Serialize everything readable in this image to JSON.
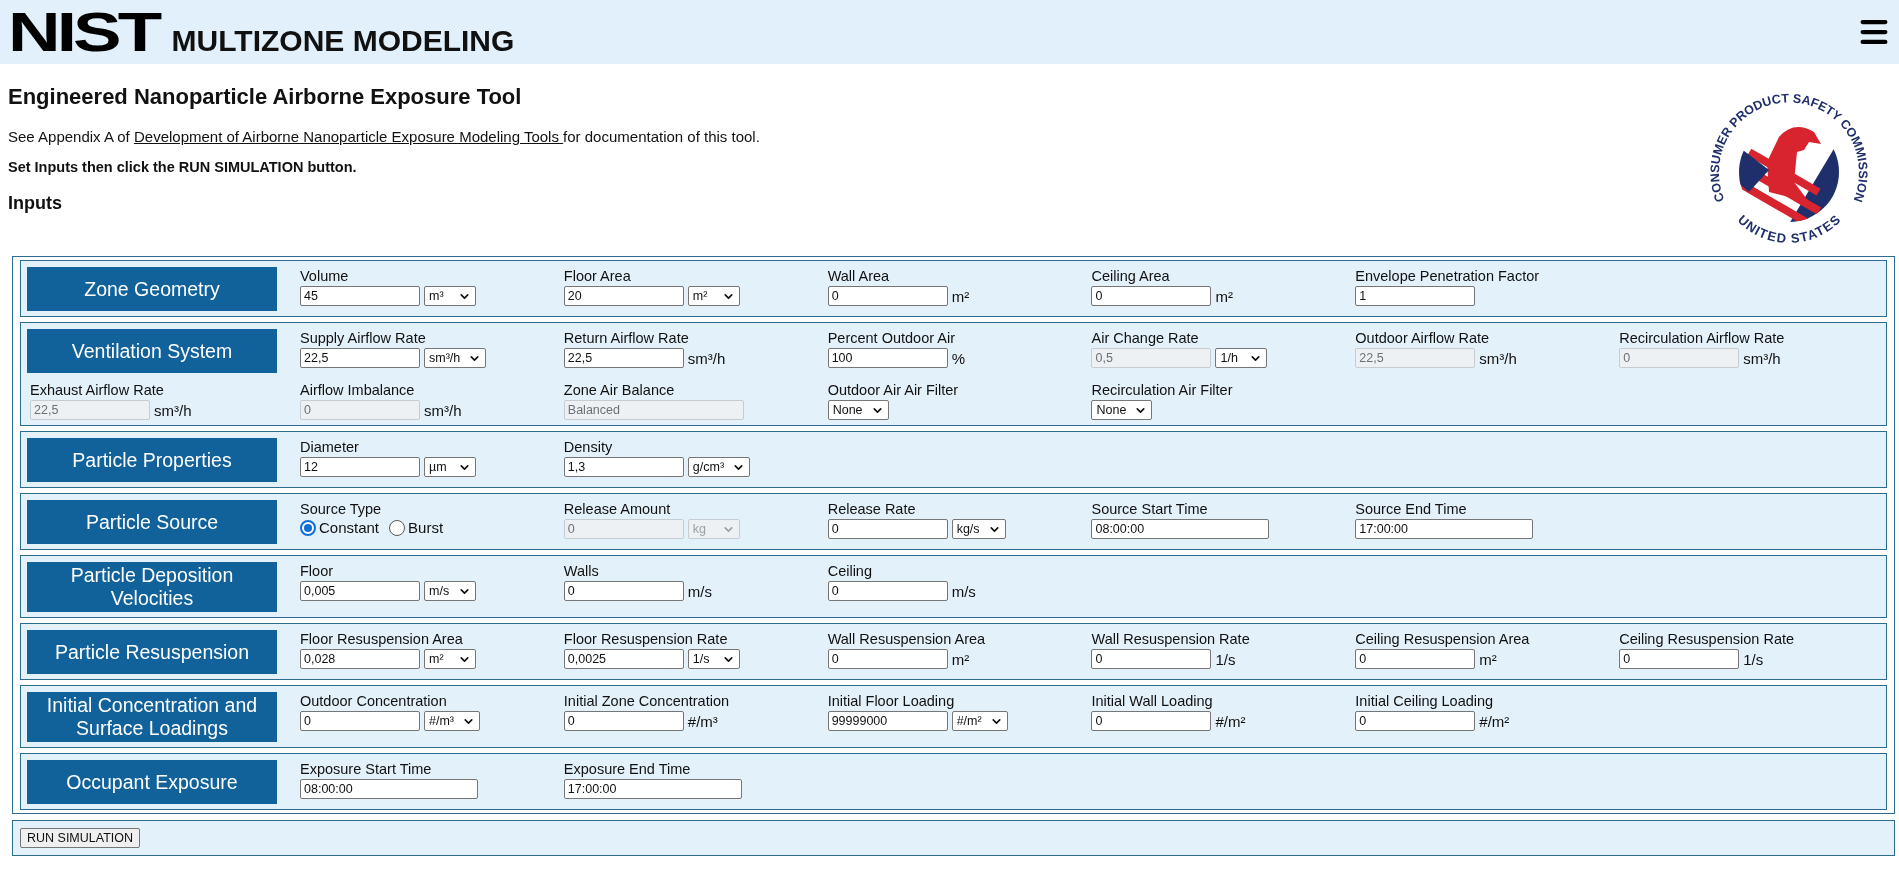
{
  "header": {
    "logo_text": "NIST",
    "title": "MULTIZONE MODELING"
  },
  "page": {
    "title": "Engineered Nanoparticle Airborne Exposure Tool",
    "intro": {
      "before": "See Appendix A of ",
      "link": "Development of Airborne Nanoparticle Exposure Modeling Tools ",
      "after": "for documentation of this tool."
    },
    "instruction": "Set Inputs then click the RUN SIMULATION button.",
    "inputs_heading": "Inputs"
  },
  "seal": {
    "top_text": "CONSUMER PRODUCT SAFETY COMMISSION",
    "bottom_text": "UNITED STATES"
  },
  "sections": [
    {
      "title": "Zone Geometry",
      "fields": [
        {
          "kind": "input",
          "label": "Volume",
          "value": "45",
          "disabled": false,
          "unit": {
            "kind": "select",
            "text": "m³",
            "disabled": false
          }
        },
        {
          "kind": "input",
          "label": "Floor Area",
          "value": "20",
          "disabled": false,
          "unit": {
            "kind": "select",
            "text": "m²",
            "disabled": false
          }
        },
        {
          "kind": "input",
          "label": "Wall Area",
          "value": "0",
          "disabled": false,
          "unit": {
            "kind": "text",
            "text": "m²"
          }
        },
        {
          "kind": "input",
          "label": "Ceiling Area",
          "value": "0",
          "disabled": false,
          "unit": {
            "kind": "text",
            "text": "m²"
          }
        },
        {
          "kind": "input",
          "label": "Envelope Penetration Factor",
          "value": "1",
          "disabled": false
        }
      ]
    },
    {
      "title": "Ventilation System",
      "fields": [
        {
          "kind": "input",
          "label": "Supply Airflow Rate",
          "value": "22,5",
          "disabled": false,
          "unit": {
            "kind": "select",
            "text": "sm³/h",
            "disabled": false
          }
        },
        {
          "kind": "input",
          "label": "Return Airflow Rate",
          "value": "22,5",
          "disabled": false,
          "unit": {
            "kind": "text",
            "text": "sm³/h"
          }
        },
        {
          "kind": "input",
          "label": "Percent Outdoor Air",
          "value": "100",
          "disabled": false,
          "unit": {
            "kind": "text",
            "text": "%"
          }
        },
        {
          "kind": "input",
          "label": "Air Change Rate",
          "value": "0,5",
          "disabled": true,
          "unit": {
            "kind": "select",
            "text": "1/h",
            "disabled": false
          }
        },
        {
          "kind": "input",
          "label": "Outdoor Airflow Rate",
          "value": "22,5",
          "disabled": true,
          "unit": {
            "kind": "text",
            "text": "sm³/h"
          }
        },
        {
          "kind": "input",
          "label": "Recirculation Airflow Rate",
          "value": "0",
          "disabled": true,
          "unit": {
            "kind": "text",
            "text": "sm³/h"
          }
        },
        {
          "kind": "input",
          "label": "Exhaust Airflow Rate",
          "value": "22,5",
          "disabled": true,
          "unit": {
            "kind": "text",
            "text": "sm³/h"
          }
        },
        {
          "kind": "input",
          "label": "Airflow Imbalance",
          "value": "0",
          "disabled": true,
          "unit": {
            "kind": "text",
            "text": "sm³/h"
          }
        },
        {
          "kind": "wide",
          "label": "Zone Air Balance",
          "value": "Balanced",
          "disabled": true
        },
        {
          "kind": "select",
          "label": "Outdoor Air Air Filter",
          "value": "None",
          "disabled": false
        },
        {
          "kind": "select",
          "label": "Recirculation Air Filter",
          "value": "None",
          "disabled": false
        }
      ]
    },
    {
      "title": "Particle Properties",
      "fields": [
        {
          "kind": "input",
          "label": "Diameter",
          "value": "12",
          "disabled": false,
          "unit": {
            "kind": "select",
            "text": "µm",
            "disabled": false
          }
        },
        {
          "kind": "input",
          "label": "Density",
          "value": "1,3",
          "disabled": false,
          "unit": {
            "kind": "select",
            "text": "g/cm³",
            "disabled": false
          }
        }
      ]
    },
    {
      "title": "Particle Source",
      "fields": [
        {
          "kind": "radio",
          "label": "Source Type",
          "options": [
            {
              "label": "Constant",
              "selected": true
            },
            {
              "label": "Burst",
              "selected": false
            }
          ]
        },
        {
          "kind": "input",
          "label": "Release Amount",
          "value": "0",
          "disabled": true,
          "unit": {
            "kind": "select",
            "text": "kg",
            "disabled": true
          }
        },
        {
          "kind": "input",
          "label": "Release Rate",
          "value": "0",
          "disabled": false,
          "unit": {
            "kind": "select",
            "text": "kg/s",
            "disabled": false
          }
        },
        {
          "kind": "time",
          "label": "Source Start Time",
          "value": "08:00:00",
          "disabled": false
        },
        {
          "kind": "time",
          "label": "Source End Time",
          "value": "17:00:00",
          "disabled": false
        }
      ]
    },
    {
      "title": "Particle Deposition Velocities",
      "fields": [
        {
          "kind": "input",
          "label": "Floor",
          "value": "0,005",
          "disabled": false,
          "unit": {
            "kind": "select",
            "text": "m/s",
            "disabled": false
          }
        },
        {
          "kind": "input",
          "label": "Walls",
          "value": "0",
          "disabled": false,
          "unit": {
            "kind": "text",
            "text": "m/s"
          }
        },
        {
          "kind": "input",
          "label": "Ceiling",
          "value": "0",
          "disabled": false,
          "unit": {
            "kind": "text",
            "text": "m/s"
          }
        }
      ]
    },
    {
      "title": "Particle Resuspension",
      "fields": [
        {
          "kind": "input",
          "label": "Floor Resuspension Area",
          "value": "0,028",
          "disabled": false,
          "unit": {
            "kind": "select",
            "text": "m²",
            "disabled": false
          }
        },
        {
          "kind": "input",
          "label": "Floor Resuspension Rate",
          "value": "0,0025",
          "disabled": false,
          "unit": {
            "kind": "select",
            "text": "1/s",
            "disabled": false
          }
        },
        {
          "kind": "input",
          "label": "Wall Resuspension Area",
          "value": "0",
          "disabled": false,
          "unit": {
            "kind": "text",
            "text": "m²"
          }
        },
        {
          "kind": "input",
          "label": "Wall Resuspension Rate",
          "value": "0",
          "disabled": false,
          "unit": {
            "kind": "text",
            "text": "1/s"
          }
        },
        {
          "kind": "input",
          "label": "Ceiling Resuspension Area",
          "value": "0",
          "disabled": false,
          "unit": {
            "kind": "text",
            "text": "m²"
          }
        },
        {
          "kind": "input",
          "label": "Ceiling Resuspension Rate",
          "value": "0",
          "disabled": false,
          "unit": {
            "kind": "text",
            "text": "1/s"
          }
        }
      ]
    },
    {
      "title": "Initial Concentration and Surface Loadings",
      "fields": [
        {
          "kind": "input",
          "label": "Outdoor Concentration",
          "value": "0",
          "disabled": false,
          "unit": {
            "kind": "select",
            "text": "#/m³",
            "disabled": false
          }
        },
        {
          "kind": "input",
          "label": "Initial Zone Concentration",
          "value": "0",
          "disabled": false,
          "unit": {
            "kind": "text",
            "text": "#/m³"
          }
        },
        {
          "kind": "input",
          "label": "Initial Floor Loading",
          "value": "99999000",
          "disabled": false,
          "unit": {
            "kind": "select",
            "text": "#/m²",
            "disabled": false
          }
        },
        {
          "kind": "input",
          "label": "Initial Wall Loading",
          "value": "0",
          "disabled": false,
          "unit": {
            "kind": "text",
            "text": "#/m²"
          }
        },
        {
          "kind": "input",
          "label": "Initial Ceiling Loading",
          "value": "0",
          "disabled": false,
          "unit": {
            "kind": "text",
            "text": "#/m²"
          }
        }
      ]
    },
    {
      "title": "Occupant Exposure",
      "fields": [
        {
          "kind": "time",
          "label": "Exposure Start Time",
          "value": "08:00:00",
          "disabled": false
        },
        {
          "kind": "time",
          "label": "Exposure End Time",
          "value": "17:00:00",
          "disabled": false
        }
      ]
    }
  ],
  "run_button": "RUN SIMULATION"
}
